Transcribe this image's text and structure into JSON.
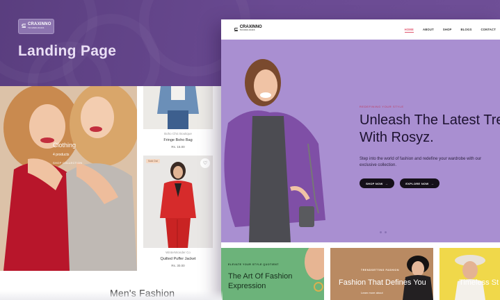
{
  "banner": {
    "brand_name": "CRAXINNO",
    "brand_tagline": "TECHNOLOGIES",
    "brand_mark": "⊆",
    "title": "Landing Page"
  },
  "shop_listing": {
    "category": {
      "name": "Clothing",
      "count": "4 products",
      "link": "SHOP COLLECTION"
    },
    "products": [
      {
        "brand": "Boho Chic Boutique",
        "name": "Fringe Boho Bag",
        "price": "Rs. 15.00"
      },
      {
        "badge": "Sold Out",
        "brand": "WinterWonder Co",
        "name": "Quilted Puffer Jacket",
        "price": "Rs. 30.00"
      }
    ],
    "section_heading": "Men's Fashion"
  },
  "site": {
    "logo_name": "CRAXINNO",
    "logo_tagline": "TECHNOLOGIES",
    "nav": [
      {
        "label": "HOME",
        "active": true
      },
      {
        "label": "ABOUT",
        "active": false
      },
      {
        "label": "SHOP",
        "active": false
      },
      {
        "label": "BLOGS",
        "active": false
      },
      {
        "label": "CONTACT",
        "active": false
      }
    ],
    "hero": {
      "eyebrow": "REDEFINING YOUR STYLE",
      "heading_line1": "Unleash The Latest Tre",
      "heading_line2": "With Rosyz.",
      "subtext": "Step into the world of fashion and redefine your wardrobe with our exclusive collection.",
      "btn_primary": "SHOP NOW",
      "btn_secondary": "EXPLORE NOW",
      "arrow": "→"
    },
    "tiles": [
      {
        "kicker": "ELEVATE YOUR STYLE QUOTIENT",
        "title": "The Art Of Fashion Expression",
        "color": "#6cb37a"
      },
      {
        "kicker": "TRENDSETTING FASHION",
        "title": "Fashion That Defines You",
        "link": "Learn more about",
        "color": "#b98a62"
      },
      {
        "title": "Timeless St",
        "color": "#f0d84a"
      }
    ]
  },
  "icons": [
    "brand-logo-icon",
    "heart-icon",
    "arrow-right-icon"
  ],
  "colors": {
    "banner": "#6a4a92",
    "hero": "#a98fd1",
    "accent_nav": "#e0566f"
  }
}
